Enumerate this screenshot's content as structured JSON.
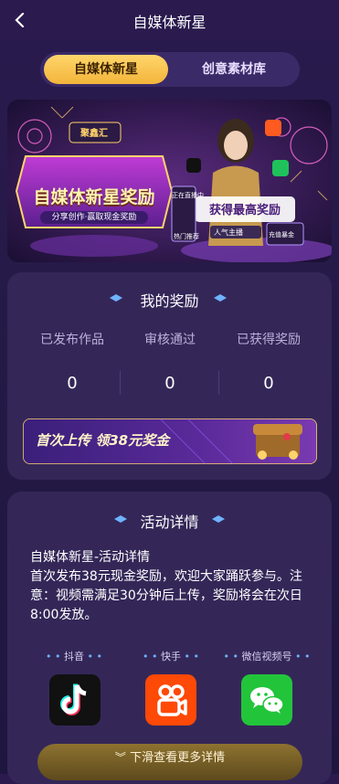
{
  "header": {
    "title": "自媒体新星"
  },
  "tabs": [
    {
      "label": "自媒体新星"
    },
    {
      "label": "创意素材库"
    }
  ],
  "banner": {
    "brand": "聚鑫汇",
    "headline": "自媒体新星奖励",
    "subline": "分享创作·赢取现金奖励",
    "badge": "获得最高奖励",
    "tag_live": "正在直播中",
    "tag_popular": "人气主播",
    "tag_recommend": "热门推荐",
    "tag_shop": "充值暴金"
  },
  "rewards": {
    "title": "我的奖励",
    "stats": [
      {
        "label": "已发布作品",
        "value": "0"
      },
      {
        "label": "审核通过",
        "value": "0"
      },
      {
        "label": "已获得奖励",
        "value": "0"
      }
    ],
    "promo_text": "首次上传 领38元奖金"
  },
  "activity": {
    "title": "活动详情",
    "heading": "自媒体新星-活动详情",
    "body": "首次发布38元现金奖励，欢迎大家踊跃参与。注意：视频需满足30分钟后上传，奖励将会在次日8:00发放。",
    "platforms": [
      {
        "label": "抖音",
        "icon": "tiktok-icon"
      },
      {
        "label": "快手",
        "icon": "kuaishou-icon"
      },
      {
        "label": "微信视频号",
        "icon": "wechat-icon"
      }
    ]
  },
  "footer": {
    "button_label": "下滑查看更多详情"
  },
  "colors": {
    "accent": "#f3b43a",
    "background": "#251a47",
    "card": "#342758"
  }
}
